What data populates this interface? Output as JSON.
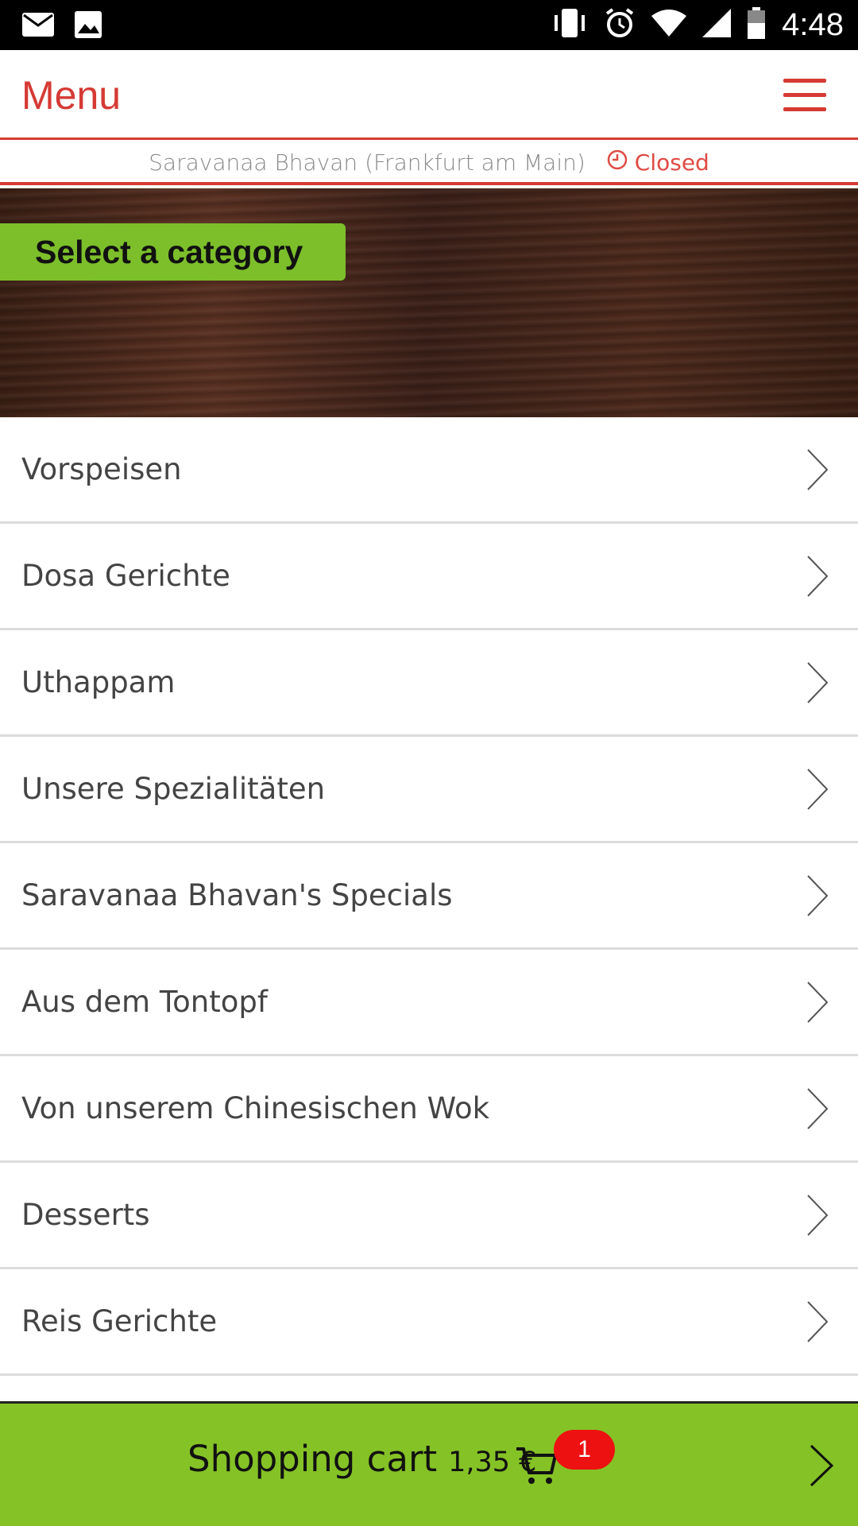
{
  "status_bar": {
    "time": "4:48",
    "icons": [
      "mail-icon",
      "image-icon",
      "vibrate-icon",
      "alarm-icon",
      "wifi-icon",
      "signal-icon",
      "battery-icon"
    ]
  },
  "app_bar": {
    "title": "Menu",
    "menu_icon": "hamburger-icon"
  },
  "restaurant": {
    "name": "Saravanaa Bhavan (Frankfurt am Main)",
    "status": "Closed"
  },
  "banner": {
    "label": "Select a category"
  },
  "categories": [
    {
      "label": "Vorspeisen"
    },
    {
      "label": "Dosa Gerichte"
    },
    {
      "label": "Uthappam"
    },
    {
      "label": "Unsere Spezialitäten"
    },
    {
      "label": "Saravanaa Bhavan's Specials"
    },
    {
      "label": "Aus dem Tontopf"
    },
    {
      "label": "Von unserem Chinesischen Wok"
    },
    {
      "label": "Desserts"
    },
    {
      "label": "Reis Gerichte"
    }
  ],
  "cart": {
    "label": "Shopping cart",
    "price": "1,35 €",
    "count": "1"
  },
  "colors": {
    "accent_red": "#d63a34",
    "green": "#85c226",
    "badge_red": "#ee1111"
  }
}
